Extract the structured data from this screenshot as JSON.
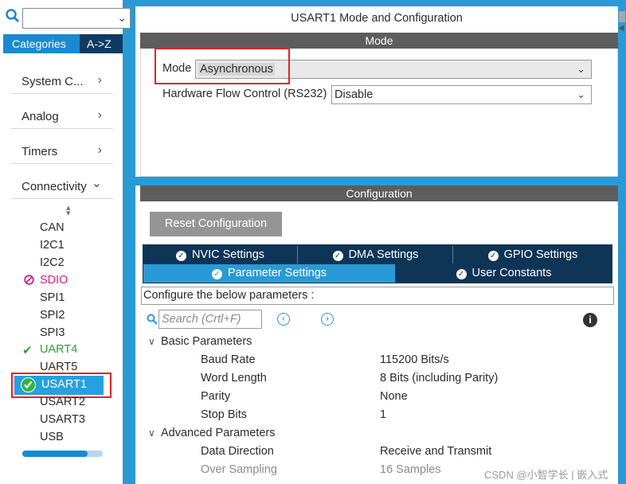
{
  "left": {
    "tabs": {
      "categories": "Categories",
      "az": "A->Z"
    },
    "categories": [
      {
        "label": "System C...",
        "chevron": "›"
      },
      {
        "label": "Analog",
        "chevron": "›"
      },
      {
        "label": "Timers",
        "chevron": "›"
      },
      {
        "label": "Connectivity",
        "chevron": "⌄"
      }
    ],
    "peripherals": [
      "CAN",
      "I2C1",
      "I2C2",
      "SDIO",
      "SPI1",
      "SPI2",
      "SPI3",
      "UART4",
      "UART5",
      "USART1",
      "USART2",
      "USART3",
      "USB"
    ]
  },
  "main": {
    "title": "USART1 Mode and Configuration",
    "mode_section": {
      "header": "Mode",
      "mode_label": "Mode",
      "mode_value": "Asynchronous",
      "hw_label": "Hardware Flow Control (RS232)",
      "hw_value": "Disable"
    },
    "config_section": {
      "header": "Configuration",
      "reset_button": "Reset Configuration",
      "tabs": [
        "NVIC Settings",
        "DMA Settings",
        "GPIO Settings",
        "Parameter Settings",
        "User Constants"
      ],
      "description": "Configure the below parameters :",
      "search_placeholder": "Search (Crtl+F)",
      "groups": [
        {
          "title": "Basic Parameters",
          "params": [
            {
              "name": "Baud Rate",
              "value": "115200 Bits/s"
            },
            {
              "name": "Word Length",
              "value": "8 Bits (including Parity)"
            },
            {
              "name": "Parity",
              "value": "None"
            },
            {
              "name": "Stop Bits",
              "value": "1"
            }
          ]
        },
        {
          "title": "Advanced Parameters",
          "params": [
            {
              "name": "Data Direction",
              "value": "Receive and Transmit"
            },
            {
              "name": "Over Sampling",
              "value": "16 Samples"
            }
          ]
        }
      ]
    }
  },
  "watermark": "CSDN @小智学长 | 嵌入式",
  "colors": {
    "accent": "#2a9ad6",
    "dark_tab": "#0e3556",
    "section_header": "#5d5d5d",
    "highlight": "#e22323",
    "enabled": "#2e9e33",
    "error": "#d01f8c"
  }
}
